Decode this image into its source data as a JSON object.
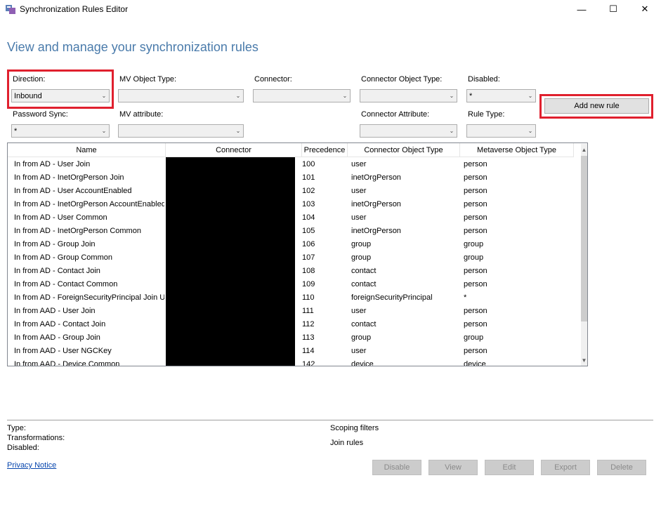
{
  "window": {
    "title": "Synchronization Rules Editor",
    "minimize_glyph": "—",
    "maximize_glyph": "☐",
    "close_glyph": "✕",
    "icon": "sync-rules-app-icon"
  },
  "heading": "View and manage your synchronization rules",
  "filters": {
    "direction": {
      "label": "Direction:",
      "value": "Inbound"
    },
    "mv_object_type": {
      "label": "MV Object Type:",
      "value": ""
    },
    "connector": {
      "label": "Connector:",
      "value": ""
    },
    "connector_object_type": {
      "label": "Connector Object Type:",
      "value": ""
    },
    "disabled": {
      "label": "Disabled:",
      "value": "*"
    },
    "password_sync": {
      "label": "Password Sync:",
      "value": "*"
    },
    "mv_attribute": {
      "label": "MV attribute:",
      "value": ""
    },
    "connector_attribute": {
      "label": "Connector Attribute:",
      "value": ""
    },
    "rule_type": {
      "label": "Rule Type:",
      "value": ""
    },
    "chevron_icon": "chevron-down-icon"
  },
  "add_new_rule_label": "Add new rule",
  "colors": {
    "highlight": "#e0202e",
    "heading": "#4a7bab",
    "link": "#0645ad"
  },
  "table": {
    "columns": [
      "Name",
      "Connector",
      "Precedence",
      "Connector Object Type",
      "Metaverse Object Type"
    ],
    "rows": [
      {
        "name": "In from AD - User Join",
        "precedence": "100",
        "cot": "user",
        "mot": "person"
      },
      {
        "name": "In from AD - InetOrgPerson Join",
        "precedence": "101",
        "cot": "inetOrgPerson",
        "mot": "person"
      },
      {
        "name": "In from AD - User AccountEnabled",
        "precedence": "102",
        "cot": "user",
        "mot": "person"
      },
      {
        "name": "In from AD - InetOrgPerson AccountEnabled",
        "precedence": "103",
        "cot": "inetOrgPerson",
        "mot": "person"
      },
      {
        "name": "In from AD - User Common",
        "precedence": "104",
        "cot": "user",
        "mot": "person"
      },
      {
        "name": "In from AD - InetOrgPerson Common",
        "precedence": "105",
        "cot": "inetOrgPerson",
        "mot": "person"
      },
      {
        "name": "In from AD - Group Join",
        "precedence": "106",
        "cot": "group",
        "mot": "group"
      },
      {
        "name": "In from AD - Group Common",
        "precedence": "107",
        "cot": "group",
        "mot": "group"
      },
      {
        "name": "In from AD - Contact Join",
        "precedence": "108",
        "cot": "contact",
        "mot": "person"
      },
      {
        "name": "In from AD - Contact Common",
        "precedence": "109",
        "cot": "contact",
        "mot": "person"
      },
      {
        "name": "In from AD - ForeignSecurityPrincipal Join Us",
        "precedence": "110",
        "cot": "foreignSecurityPrincipal",
        "mot": "*"
      },
      {
        "name": "In from AAD - User Join",
        "precedence": "111",
        "cot": "user",
        "mot": "person"
      },
      {
        "name": "In from AAD - Contact Join",
        "precedence": "112",
        "cot": "contact",
        "mot": "person"
      },
      {
        "name": "In from AAD - Group Join",
        "precedence": "113",
        "cot": "group",
        "mot": "group"
      },
      {
        "name": "In from AAD - User NGCKey",
        "precedence": "114",
        "cot": "user",
        "mot": "person"
      },
      {
        "name": "In from AAD - Device Common",
        "precedence": "142",
        "cot": "device",
        "mot": "device"
      }
    ],
    "scroll_up_glyph": "▲",
    "scroll_down_glyph": "▼"
  },
  "details": {
    "type_label": "Type:",
    "transformations_label": "Transformations:",
    "disabled_label": "Disabled:",
    "scoping_filters_label": "Scoping filters",
    "join_rules_label": "Join rules"
  },
  "privacy_notice": "Privacy Notice",
  "actions": {
    "disable": "Disable",
    "view": "View",
    "edit": "Edit",
    "export": "Export",
    "delete": "Delete"
  }
}
